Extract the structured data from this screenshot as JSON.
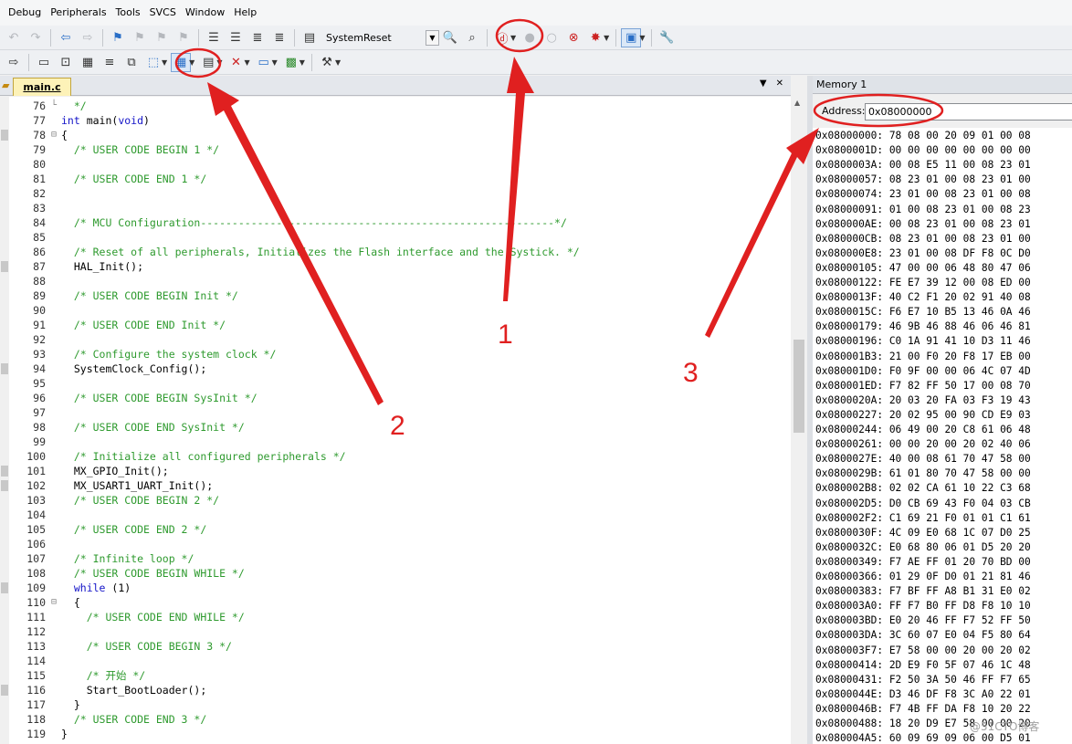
{
  "menu": [
    "Debug",
    "Peripherals",
    "Tools",
    "SVCS",
    "Window",
    "Help"
  ],
  "toolbar1": {
    "target_name": "SystemReset"
  },
  "editor": {
    "tab_label": "main.c",
    "lines": [
      {
        "n": "76",
        "fold": "└",
        "code": [
          {
            "t": "  */",
            "c": "com"
          }
        ]
      },
      {
        "n": "77",
        "fold": "",
        "code": [
          {
            "t": "int",
            "c": "kw"
          },
          {
            "t": " main(",
            "c": "txt"
          },
          {
            "t": "void",
            "c": "kw"
          },
          {
            "t": ")",
            "c": "txt"
          }
        ]
      },
      {
        "n": "78",
        "fold": "⊟",
        "mark": true,
        "code": [
          {
            "t": "{",
            "c": "txt"
          }
        ]
      },
      {
        "n": "79",
        "fold": "",
        "code": [
          {
            "t": "  /* USER CODE BEGIN 1 */",
            "c": "com"
          }
        ]
      },
      {
        "n": "80",
        "fold": "",
        "code": []
      },
      {
        "n": "81",
        "fold": "",
        "code": [
          {
            "t": "  /* USER CODE END 1 */",
            "c": "com"
          }
        ]
      },
      {
        "n": "82",
        "fold": "",
        "code": []
      },
      {
        "n": "83",
        "fold": "",
        "code": []
      },
      {
        "n": "84",
        "fold": "",
        "code": [
          {
            "t": "  /* MCU Configuration--------------------------------------------------------*/",
            "c": "com"
          }
        ]
      },
      {
        "n": "85",
        "fold": "",
        "code": []
      },
      {
        "n": "86",
        "fold": "",
        "code": [
          {
            "t": "  /* Reset of all peripherals, Initializes the Flash interface and the Systick. */",
            "c": "com"
          }
        ]
      },
      {
        "n": "87",
        "fold": "",
        "mark": true,
        "code": [
          {
            "t": "  HAL_Init();",
            "c": "txt"
          }
        ]
      },
      {
        "n": "88",
        "fold": "",
        "code": []
      },
      {
        "n": "89",
        "fold": "",
        "code": [
          {
            "t": "  /* USER CODE BEGIN Init */",
            "c": "com"
          }
        ]
      },
      {
        "n": "90",
        "fold": "",
        "code": []
      },
      {
        "n": "91",
        "fold": "",
        "code": [
          {
            "t": "  /* USER CODE END Init */",
            "c": "com"
          }
        ]
      },
      {
        "n": "92",
        "fold": "",
        "code": []
      },
      {
        "n": "93",
        "fold": "",
        "code": [
          {
            "t": "  /* Configure the system clock */",
            "c": "com"
          }
        ]
      },
      {
        "n": "94",
        "fold": "",
        "mark": true,
        "code": [
          {
            "t": "  SystemClock_Config();",
            "c": "txt"
          }
        ]
      },
      {
        "n": "95",
        "fold": "",
        "code": []
      },
      {
        "n": "96",
        "fold": "",
        "code": [
          {
            "t": "  /* USER CODE BEGIN SysInit */",
            "c": "com"
          }
        ]
      },
      {
        "n": "97",
        "fold": "",
        "code": []
      },
      {
        "n": "98",
        "fold": "",
        "code": [
          {
            "t": "  /* USER CODE END SysInit */",
            "c": "com"
          }
        ]
      },
      {
        "n": "99",
        "fold": "",
        "code": []
      },
      {
        "n": "100",
        "fold": "",
        "code": [
          {
            "t": "  /* Initialize all configured peripherals */",
            "c": "com"
          }
        ]
      },
      {
        "n": "101",
        "fold": "",
        "mark": true,
        "code": [
          {
            "t": "  MX_GPIO_Init();",
            "c": "txt"
          }
        ]
      },
      {
        "n": "102",
        "fold": "",
        "mark": true,
        "code": [
          {
            "t": "  MX_USART1_UART_Init();",
            "c": "txt"
          }
        ]
      },
      {
        "n": "103",
        "fold": "",
        "code": [
          {
            "t": "  /* USER CODE BEGIN 2 */",
            "c": "com"
          }
        ]
      },
      {
        "n": "104",
        "fold": "",
        "code": []
      },
      {
        "n": "105",
        "fold": "",
        "code": [
          {
            "t": "  /* USER CODE END 2 */",
            "c": "com"
          }
        ]
      },
      {
        "n": "106",
        "fold": "",
        "code": []
      },
      {
        "n": "107",
        "fold": "",
        "code": [
          {
            "t": "  /* Infinite loop */",
            "c": "com"
          }
        ]
      },
      {
        "n": "108",
        "fold": "",
        "code": [
          {
            "t": "  /* USER CODE BEGIN WHILE */",
            "c": "com"
          }
        ]
      },
      {
        "n": "109",
        "fold": "",
        "mark": true,
        "code": [
          {
            "t": "  while",
            "c": "kw"
          },
          {
            "t": " (1)",
            "c": "txt"
          }
        ]
      },
      {
        "n": "110",
        "fold": "⊟",
        "code": [
          {
            "t": "  {",
            "c": "txt"
          }
        ]
      },
      {
        "n": "111",
        "fold": "",
        "code": [
          {
            "t": "    /* USER CODE END WHILE */",
            "c": "com"
          }
        ]
      },
      {
        "n": "112",
        "fold": "",
        "code": []
      },
      {
        "n": "113",
        "fold": "",
        "code": [
          {
            "t": "    /* USER CODE BEGIN 3 */",
            "c": "com"
          }
        ]
      },
      {
        "n": "114",
        "fold": "",
        "code": []
      },
      {
        "n": "115",
        "fold": "",
        "code": [
          {
            "t": "    /* 开始 */",
            "c": "com"
          }
        ]
      },
      {
        "n": "116",
        "fold": "",
        "mark": true,
        "code": [
          {
            "t": "    Start_BootLoader();",
            "c": "txt"
          }
        ]
      },
      {
        "n": "117",
        "fold": "",
        "code": [
          {
            "t": "  }",
            "c": "txt"
          }
        ]
      },
      {
        "n": "118",
        "fold": "",
        "code": [
          {
            "t": "  /* USER CODE END 3 */",
            "c": "com"
          }
        ]
      },
      {
        "n": "119",
        "fold": "",
        "code": [
          {
            "t": "}",
            "c": "txt"
          }
        ]
      }
    ]
  },
  "memory": {
    "title": "Memory 1",
    "address_label": "Address:",
    "address_value": "0x08000000",
    "rows": [
      "0x08000000: 78 08 00 20 09 01 00 08",
      "0x0800001D: 00 00 00 00 00 00 00 00",
      "0x0800003A: 00 08 E5 11 00 08 23 01",
      "0x08000057: 08 23 01 00 08 23 01 00",
      "0x08000074: 23 01 00 08 23 01 00 08",
      "0x08000091: 01 00 08 23 01 00 08 23",
      "0x080000AE: 00 08 23 01 00 08 23 01",
      "0x080000CB: 08 23 01 00 08 23 01 00",
      "0x080000E8: 23 01 00 08 DF F8 0C D0",
      "0x08000105: 47 00 00 06 48 80 47 06",
      "0x08000122: FE E7 39 12 00 08 ED 00",
      "0x0800013F: 40 C2 F1 20 02 91 40 08",
      "0x0800015C: F6 E7 10 B5 13 46 0A 46",
      "0x08000179: 46 9B 46 88 46 06 46 81",
      "0x08000196: C0 1A 91 41 10 D3 11 46",
      "0x080001B3: 21 00 F0 20 F8 17 EB 00",
      "0x080001D0: F0 9F 00 00 06 4C 07 4D",
      "0x080001ED: F7 82 FF 50 17 00 08 70",
      "0x0800020A: 20 03 20 FA 03 F3 19 43",
      "0x08000227: 20 02 95 00 90 CD E9 03",
      "0x08000244: 06 49 00 20 C8 61 06 48",
      "0x08000261: 00 00 20 00 20 02 40 06",
      "0x0800027E: 40 00 08 61 70 47 58 00",
      "0x0800029B: 61 01 80 70 47 58 00 00",
      "0x080002B8: 02 02 CA 61 10 22 C3 68",
      "0x080002D5: D0 CB 69 43 F0 04 03 CB",
      "0x080002F2: C1 69 21 F0 01 01 C1 61",
      "0x0800030F: 4C 09 E0 68 1C 07 D0 25",
      "0x0800032C: E0 68 80 06 01 D5 20 20",
      "0x08000349: F7 AE FF 01 20 70 BD 00",
      "0x08000366: 01 29 0F D0 01 21 81 46",
      "0x08000383: F7 BF FF A8 B1 31 E0 02",
      "0x080003A0: FF F7 B0 FF D8 F8 10 10",
      "0x080003BD: E0 20 46 FF F7 52 FF 50",
      "0x080003DA: 3C 60 07 E0 04 F5 80 64",
      "0x080003F7: E7 58 00 00 20 00 20 02",
      "0x08000414: 2D E9 F0 5F 07 46 1C 48",
      "0x08000431: F2 50 3A 50 46 FF F7 65",
      "0x0800044E: D3 46 DF F8 3C A0 22 01",
      "0x0800046B: F7 4B FF DA F8 10 20 22",
      "0x08000488: 18 20 D9 E7 58 00 00 20",
      "0x080004A5: 60 09 69 09 06 00 D5 01"
    ]
  },
  "annotations": {
    "label_1": "1",
    "label_2": "2",
    "label_3": "3"
  },
  "watermark": "@51CTO博客",
  "colors": {
    "annotation": "#e02020",
    "comment": "#2e9a2e",
    "keyword": "#1515c8"
  }
}
